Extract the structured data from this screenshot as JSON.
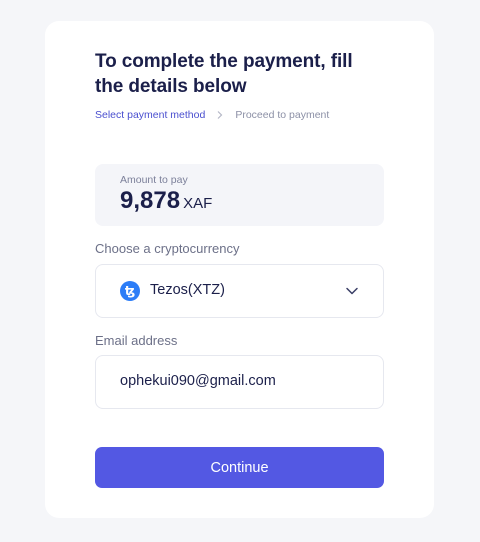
{
  "header": {
    "title": "To complete the payment, fill the details below"
  },
  "breadcrumb": {
    "step1": "Select payment method",
    "step2": "Proceed to payment"
  },
  "amount": {
    "label": "Amount to pay",
    "value": "9,878",
    "currency": "XAF"
  },
  "crypto": {
    "label": "Choose a cryptocurrency",
    "selected": "Tezos(XTZ)",
    "icon_glyph": "ꜩ",
    "icon": "tezos-icon"
  },
  "email": {
    "label": "Email address",
    "value": "ophekui090@gmail.com"
  },
  "actions": {
    "continue_label": "Continue"
  },
  "colors": {
    "accent": "#5358e3",
    "breadcrumb_active": "#4a4fcf",
    "coin": "#2c7df7"
  }
}
